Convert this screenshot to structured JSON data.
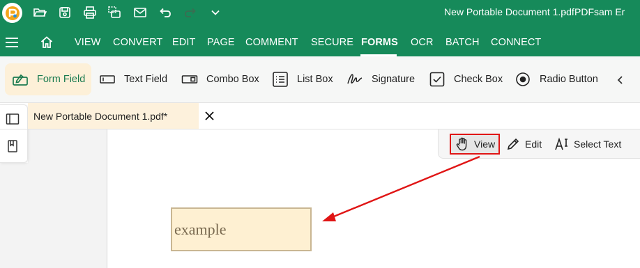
{
  "titlebar": {
    "document_title": "New Portable Document 1.pdf",
    "separator": "-",
    "app_name": "PDFsam Er"
  },
  "quick_access": [
    "open-folder-icon",
    "save-icon",
    "print-icon",
    "scan-print-icon",
    "email-icon",
    "undo-icon",
    "redo-icon",
    "more-chevron-icon"
  ],
  "menu": {
    "items": [
      "VIEW",
      "CONVERT",
      "EDIT",
      "PAGE",
      "COMMENT",
      "SECURE",
      "FORMS",
      "OCR",
      "BATCH",
      "CONNECT"
    ],
    "active": "FORMS"
  },
  "toolbar": {
    "tools": [
      {
        "label": "Form Field",
        "icon": "form-field-icon",
        "active": true
      },
      {
        "label": "Text Field",
        "icon": "text-field-icon"
      },
      {
        "label": "Combo Box",
        "icon": "combo-box-icon"
      },
      {
        "label": "List Box",
        "icon": "list-box-icon"
      },
      {
        "label": "Signature",
        "icon": "signature-icon"
      },
      {
        "label": "Check Box",
        "icon": "check-box-icon"
      },
      {
        "label": "Radio Button",
        "icon": "radio-button-icon"
      }
    ]
  },
  "tab": {
    "title": "New Portable Document 1.pdf*"
  },
  "mode_bar": {
    "view_label": "View",
    "edit_label": "Edit",
    "select_text_label": "Select Text"
  },
  "document": {
    "field_text": "example"
  },
  "colors": {
    "brand_green": "#168a5a",
    "active_tool_bg": "#fdf0d8",
    "highlight_red": "#e01515",
    "field_bg": "#fef0d2"
  }
}
